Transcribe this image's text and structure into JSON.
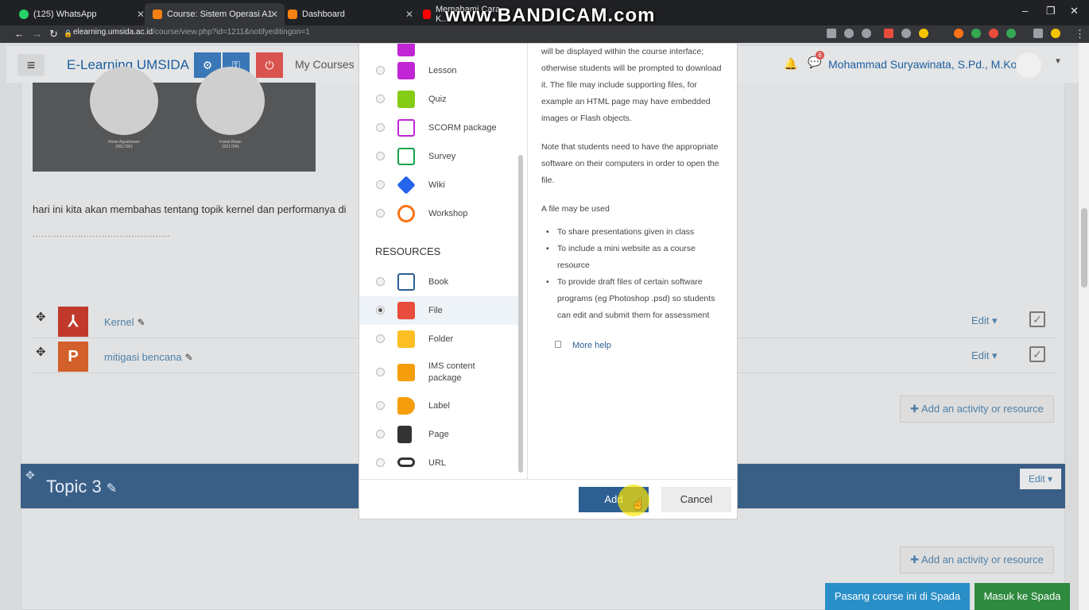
{
  "browser": {
    "tabs": [
      {
        "label": "(125) WhatsApp",
        "color": "#25d366"
      },
      {
        "label": "Course: Sistem Operasi A1",
        "color": "#f98012"
      },
      {
        "label": "Dashboard",
        "color": "#f98012"
      },
      {
        "label": "Memahami Cara K...",
        "color": "#ff0000"
      }
    ],
    "url_host": "elearning.umsida.ac.id",
    "url_path": "/course/view.php?id=1211&notifyeditingon=1",
    "watermark": "www.BANDICAM.com"
  },
  "navbar": {
    "brand": "E-Learning UMSIDA",
    "my_courses": "My Courses",
    "notification_count": "6",
    "user_name": "Mohammad Suryawinata, S.Pd., M.Kom"
  },
  "course": {
    "banner_people": [
      {
        "name": "Rivan Agustiawan",
        "id": "10517061"
      },
      {
        "name": "Faizal Alwan",
        "id": "10517041"
      }
    ],
    "paragraph": "hari ini kita akan membahas tentang topik kernel dan performanya di",
    "dots": "..............................................",
    "activities": [
      {
        "name": "Kernel",
        "edit": "Edit",
        "icon": "pdf-icon",
        "color": "#c0392b"
      },
      {
        "name": "mitigasi bencana",
        "edit": "Edit",
        "icon": "powerpoint-icon",
        "color": "#d35f2a"
      }
    ],
    "add_activity": "Add an activity or resource",
    "topic3": {
      "title": "Topic 3",
      "edit": "Edit",
      "add_activity": "Add an activity or resource"
    },
    "buttons": {
      "pasang": "Pasang course ini di Spada",
      "masuk": "Masuk ke Spada"
    }
  },
  "modal": {
    "activities": [
      {
        "label": "Lesson",
        "icon": "lesson-icon",
        "color": "#c026d3"
      },
      {
        "label": "Quiz",
        "icon": "quiz-icon",
        "color": "#84cc16"
      },
      {
        "label": "SCORM package",
        "icon": "scorm-icon",
        "color": "#c026d3"
      },
      {
        "label": "Survey",
        "icon": "survey-icon",
        "color": "#16a34a"
      },
      {
        "label": "Wiki",
        "icon": "wiki-icon",
        "color": "#2563eb"
      },
      {
        "label": "Workshop",
        "icon": "workshop-icon",
        "color": "#f97316"
      }
    ],
    "resources_heading": "RESOURCES",
    "resources": [
      {
        "label": "Book",
        "icon": "book-icon",
        "color": "#2d5f93"
      },
      {
        "label": "File",
        "icon": "file-icon",
        "color": "#e74c3c",
        "selected": true
      },
      {
        "label": "Folder",
        "icon": "folder-icon",
        "color": "#fbbf24"
      },
      {
        "label": "IMS content package",
        "icon": "ims-package-icon",
        "color": "#f59e0b"
      },
      {
        "label": "Label",
        "icon": "label-icon",
        "color": "#f59e0b"
      },
      {
        "label": "Page",
        "icon": "page-icon",
        "color": "#333333"
      },
      {
        "label": "URL",
        "icon": "url-icon",
        "color": "#333333"
      }
    ],
    "description": {
      "p1": "will be displayed within the course interface; otherwise students will be prompted to download it. The file may include supporting files, for example an HTML page may have embedded images or Flash objects.",
      "p2": "Note that students need to have the appropriate software on their computers in order to open the file.",
      "p3": "A file may be used",
      "bullets": [
        "To share presentations given in class",
        "To include a mini website as a course resource",
        "To provide draft files of certain software programs (eg Photoshop .psd) so students can edit and submit them for assessment"
      ],
      "more_help": "More help"
    },
    "add_button": "Add",
    "cancel_button": "Cancel"
  }
}
